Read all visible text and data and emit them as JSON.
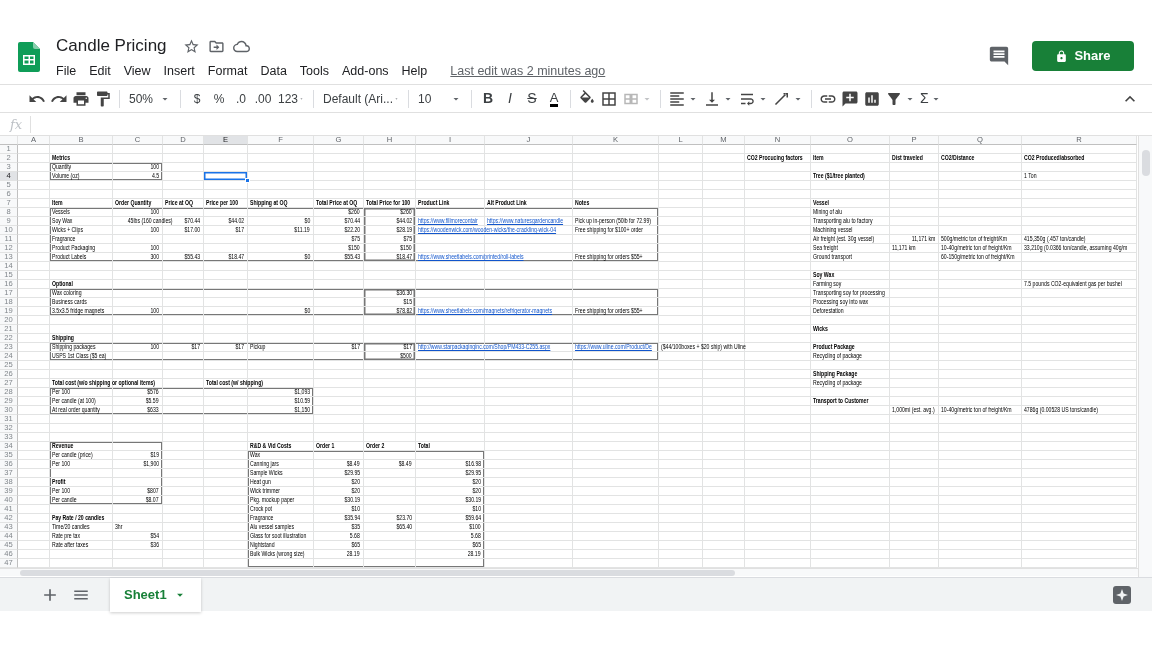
{
  "document": {
    "title": "Candle Pricing",
    "last_edit": "Last edit was 2 minutes ago"
  },
  "menu": [
    "File",
    "Edit",
    "View",
    "Insert",
    "Format",
    "Data",
    "Tools",
    "Add-ons",
    "Help"
  ],
  "share_button": "Share",
  "toolbar": {
    "zoom": "50%",
    "currency": "$",
    "percent": "%",
    "decrease_decimals": ".0",
    "increase_decimals": ".00",
    "number_format": "123",
    "font": "Default (Ari...",
    "font_size": "10",
    "bold": "B",
    "italic": "I",
    "strikethrough": "S",
    "text_color": "A",
    "merge": {
      "disabled": true
    },
    "functions": "Σ"
  },
  "formula_bar": {
    "label": "fx"
  },
  "columns": [
    {
      "label": "A",
      "selected": false
    },
    {
      "label": "B",
      "selected": false
    },
    {
      "label": "C",
      "selected": false
    },
    {
      "label": "D",
      "selected": false
    },
    {
      "label": "E",
      "selected": true
    },
    {
      "label": "F",
      "selected": false
    },
    {
      "label": "G",
      "selected": false
    },
    {
      "label": "H",
      "selected": false
    },
    {
      "label": "I",
      "selected": false
    },
    {
      "label": "J",
      "selected": false
    },
    {
      "label": "K",
      "selected": false
    },
    {
      "label": "L",
      "selected": false
    },
    {
      "label": "M",
      "selected": false
    },
    {
      "label": "N",
      "selected": false
    },
    {
      "label": "O",
      "selected": false
    },
    {
      "label": "P",
      "selected": false
    },
    {
      "label": "Q",
      "selected": false
    },
    {
      "label": "R",
      "selected": false
    }
  ],
  "rows": [
    {
      "number": "1",
      "selected": false
    },
    {
      "number": "2",
      "selected": false,
      "cells": {
        "B": {
          "kind": "heading",
          "text": "Metrics"
        },
        "N": {
          "kind": "heading",
          "text": "CO2 Procucing factors"
        },
        "O": {
          "kind": "heading",
          "text": "Item"
        },
        "P": {
          "kind": "heading",
          "text": "Dist traveled"
        },
        "Q": {
          "kind": "heading",
          "text": "CO2/Distance"
        },
        "R": {
          "kind": "heading",
          "text": "CO2 Produced/absorbed"
        }
      }
    },
    {
      "number": "3",
      "selected": false,
      "cells": {
        "B": {
          "kind": "text",
          "text": "Quantity"
        },
        "C": {
          "kind": "number",
          "text": "100"
        }
      }
    },
    {
      "number": "4",
      "selected": true,
      "cells": {
        "B": {
          "kind": "text",
          "text": "Volume (oz)"
        },
        "C": {
          "kind": "number",
          "text": "4.5"
        },
        "O": {
          "kind": "heading",
          "text": "Tree ($1/tree planted)"
        },
        "R": {
          "kind": "text",
          "text": "1 Ton"
        }
      }
    },
    {
      "number": "5",
      "selected": false
    },
    {
      "number": "6",
      "selected": false
    },
    {
      "number": "7",
      "selected": false,
      "cells": {
        "B": {
          "kind": "heading",
          "text": "Item"
        },
        "C": {
          "kind": "heading",
          "text": "Order Quantity"
        },
        "D": {
          "kind": "heading",
          "text": "Price at OQ"
        },
        "E": {
          "kind": "heading",
          "text": "Price per 100"
        },
        "F": {
          "kind": "heading",
          "text": "Shipping at OQ"
        },
        "G": {
          "kind": "heading",
          "text": "Total Price at OQ"
        },
        "H": {
          "kind": "heading",
          "text": "Total Price for 100"
        },
        "I": {
          "kind": "heading",
          "text": "Product Link"
        },
        "J": {
          "kind": "heading",
          "text": "Alt Product Link"
        },
        "K": {
          "kind": "heading",
          "text": "Notes"
        },
        "O": {
          "kind": "heading",
          "text": "Vessel"
        }
      }
    },
    {
      "number": "8",
      "selected": false,
      "cells": {
        "B": {
          "kind": "text",
          "text": "Vessels"
        },
        "C": {
          "kind": "number",
          "text": "100"
        },
        "G": {
          "kind": "number",
          "text": "$260"
        },
        "H": {
          "kind": "number",
          "text": "$260"
        },
        "O": {
          "kind": "text",
          "text": "Mining of alu"
        }
      }
    },
    {
      "number": "9",
      "selected": false,
      "cells": {
        "B": {
          "kind": "text",
          "text": "Soy Wax"
        },
        "C": {
          "kind": "number",
          "text": "45lbs (160 candles)"
        },
        "D": {
          "kind": "number",
          "text": "$70.44"
        },
        "E": {
          "kind": "number",
          "text": "$44.02"
        },
        "F": {
          "kind": "number",
          "text": "$0"
        },
        "G": {
          "kind": "number",
          "text": "$70.44"
        },
        "H": {
          "kind": "number",
          "text": "$44.02"
        },
        "I": {
          "kind": "link",
          "text": "https://www.fillmorecontair"
        },
        "J": {
          "kind": "link",
          "text": "https://www.naturesgardencandle"
        },
        "K": {
          "kind": "text",
          "text": "Pick up in-person (50lb for 72.99)"
        },
        "O": {
          "kind": "text",
          "text": "Transporting alu to factory"
        }
      }
    },
    {
      "number": "10",
      "selected": false,
      "cells": {
        "B": {
          "kind": "text",
          "text": "Wicks + Clips"
        },
        "C": {
          "kind": "number",
          "text": "100"
        },
        "D": {
          "kind": "number",
          "text": "$17.00"
        },
        "E": {
          "kind": "number",
          "text": "$17"
        },
        "F": {
          "kind": "number",
          "text": "$11.19"
        },
        "G": {
          "kind": "number",
          "text": "$22.20"
        },
        "H": {
          "kind": "number",
          "text": "$28.19"
        },
        "I": {
          "kind": "link",
          "text": "https://woodenwick.com/wooden-wicks/the-crackling-wick-04"
        },
        "K": {
          "kind": "text",
          "text": "Free shipping for $100+ order"
        },
        "O": {
          "kind": "text",
          "text": "Machining vessel"
        }
      }
    },
    {
      "number": "11",
      "selected": false,
      "cells": {
        "B": {
          "kind": "text",
          "text": "Fragrance"
        },
        "G": {
          "kind": "number",
          "text": "$75"
        },
        "H": {
          "kind": "number",
          "text": "$75"
        },
        "O": {
          "kind": "text",
          "text": "Air freight (est. 30g vessel)"
        },
        "P": {
          "kind": "number",
          "text": "11,171 km"
        },
        "Q": {
          "kind": "text",
          "text": "500g/metric ton of freight/Km"
        },
        "R": {
          "kind": "text",
          "text": "415,350g (.457 ton/candle)"
        }
      }
    },
    {
      "number": "12",
      "selected": false,
      "cells": {
        "B": {
          "kind": "text",
          "text": "Product Packaging"
        },
        "C": {
          "kind": "number",
          "text": "100"
        },
        "G": {
          "kind": "number",
          "text": "$150"
        },
        "H": {
          "kind": "number",
          "text": "$150"
        },
        "O": {
          "kind": "text",
          "text": "Sea freight"
        },
        "P": {
          "kind": "text",
          "text": "11,171 km"
        },
        "Q": {
          "kind": "text",
          "text": "10-40g/metric ton of freight/Km"
        },
        "R": {
          "kind": "text",
          "text": "33,210g (0.0366 ton/candle, assuming 40g/m"
        }
      }
    },
    {
      "number": "13",
      "selected": false,
      "cells": {
        "B": {
          "kind": "text",
          "text": "Product Labels"
        },
        "C": {
          "kind": "number",
          "text": "300"
        },
        "D": {
          "kind": "number",
          "text": "$55.43"
        },
        "E": {
          "kind": "number",
          "text": "$18.47"
        },
        "F": {
          "kind": "number",
          "text": "$0"
        },
        "G": {
          "kind": "number",
          "text": "$55.43"
        },
        "H": {
          "kind": "number",
          "text": "$18.47"
        },
        "I": {
          "kind": "link",
          "text": "https://www.sheetlabels.com/printed/roll-labels"
        },
        "K": {
          "kind": "text",
          "text": "Free shipping for orders $55+"
        },
        "O": {
          "kind": "text",
          "text": "Ground transport"
        },
        "Q": {
          "kind": "text",
          "text": "60-150g/metric ton of freight/Km"
        }
      }
    },
    {
      "number": "14",
      "selected": false
    },
    {
      "number": "15",
      "selected": false,
      "cells": {
        "O": {
          "kind": "heading",
          "text": "Soy Wax"
        }
      }
    },
    {
      "number": "16",
      "selected": false,
      "cells": {
        "B": {
          "kind": "heading",
          "text": "Optional"
        },
        "O": {
          "kind": "text",
          "text": "Farming soy"
        },
        "R": {
          "kind": "text",
          "text": "7.5 pounds CO2-equivalent gas per bushel"
        }
      }
    },
    {
      "number": "17",
      "selected": false,
      "cells": {
        "B": {
          "kind": "text",
          "text": "Wax coloring"
        },
        "H": {
          "kind": "number",
          "text": "$36.30"
        },
        "O": {
          "kind": "text",
          "text": "Transporting soy for processing"
        }
      }
    },
    {
      "number": "18",
      "selected": false,
      "cells": {
        "B": {
          "kind": "text",
          "text": "Business cards"
        },
        "H": {
          "kind": "number",
          "text": "$15"
        },
        "O": {
          "kind": "text",
          "text": "Processing soy into wax"
        }
      }
    },
    {
      "number": "19",
      "selected": false,
      "cells": {
        "B": {
          "kind": "text",
          "text": "3.5x3.5 fridge magnets"
        },
        "C": {
          "kind": "number",
          "text": "100"
        },
        "F": {
          "kind": "number",
          "text": "$0"
        },
        "H": {
          "kind": "number",
          "text": "$78.82"
        },
        "I": {
          "kind": "link",
          "text": "https://www.sheetlabels.com/magnets/refrigerator-magnets"
        },
        "K": {
          "kind": "text",
          "text": "Free shipping for orders $55+"
        },
        "O": {
          "kind": "text",
          "text": "Deforestation"
        }
      }
    },
    {
      "number": "20",
      "selected": false
    },
    {
      "number": "21",
      "selected": false,
      "cells": {
        "O": {
          "kind": "heading",
          "text": "Wicks"
        }
      }
    },
    {
      "number": "22",
      "selected": false,
      "cells": {
        "B": {
          "kind": "heading",
          "text": "Shipping"
        }
      }
    },
    {
      "number": "23",
      "selected": false,
      "cells": {
        "B": {
          "kind": "text",
          "text": "Shipping packages"
        },
        "C": {
          "kind": "number",
          "text": "100"
        },
        "D": {
          "kind": "number",
          "text": "$17"
        },
        "E": {
          "kind": "number",
          "text": "$17"
        },
        "F": {
          "kind": "text",
          "text": "Pickup"
        },
        "G": {
          "kind": "number",
          "text": "$17"
        },
        "H": {
          "kind": "number",
          "text": "$17"
        },
        "I": {
          "kind": "link",
          "text": "http://www.starpackaginginc.com/Shop/PM433-C255.aspx"
        },
        "K": {
          "kind": "link",
          "text": "https://www.uline.com/Product/De"
        },
        "L": {
          "kind": "text",
          "text": "($44/100boxes + $20 ship) with Uline"
        },
        "O": {
          "kind": "heading",
          "text": "Product Package"
        }
      }
    },
    {
      "number": "24",
      "selected": false,
      "cells": {
        "B": {
          "kind": "text",
          "text": "USPS 1st Class ($5 ea)"
        },
        "H": {
          "kind": "number",
          "text": "$500"
        },
        "O": {
          "kind": "text",
          "text": "Recycling of package"
        }
      }
    },
    {
      "number": "25",
      "selected": false
    },
    {
      "number": "26",
      "selected": false,
      "cells": {
        "O": {
          "kind": "heading",
          "text": "Shipping Package"
        }
      }
    },
    {
      "number": "27",
      "selected": false,
      "cells": {
        "B": {
          "kind": "heading",
          "text": "Total cost (w/o shipping or optional items)"
        },
        "E": {
          "kind": "heading",
          "text": "Total cost (w/ shipping)"
        },
        "O": {
          "kind": "text",
          "text": "Recycling of package"
        }
      }
    },
    {
      "number": "28",
      "selected": false,
      "cells": {
        "B": {
          "kind": "text",
          "text": "Per 100"
        },
        "C": {
          "kind": "number",
          "text": "$576"
        },
        "F": {
          "kind": "number",
          "text": "$1,093"
        }
      }
    },
    {
      "number": "29",
      "selected": false,
      "cells": {
        "B": {
          "kind": "text",
          "text": "Per candle (at 100)"
        },
        "C": {
          "kind": "number",
          "text": "$5.59"
        },
        "F": {
          "kind": "number",
          "text": "$10.59"
        },
        "O": {
          "kind": "heading",
          "text": "Transport to Customer"
        }
      }
    },
    {
      "number": "30",
      "selected": false,
      "cells": {
        "B": {
          "kind": "text",
          "text": "At real order quantity"
        },
        "C": {
          "kind": "number",
          "text": "$633"
        },
        "F": {
          "kind": "number",
          "text": "$1,150"
        },
        "P": {
          "kind": "text",
          "text": "1,000mi (est. avg.)"
        },
        "Q": {
          "kind": "text",
          "text": "10-40g/metric ton of freight/Km"
        },
        "R": {
          "kind": "text",
          "text": "4786g (0.00528 US tons/candle)"
        }
      }
    },
    {
      "number": "31",
      "selected": false
    },
    {
      "number": "32",
      "selected": false
    },
    {
      "number": "33",
      "selected": false
    },
    {
      "number": "34",
      "selected": false,
      "cells": {
        "B": {
          "kind": "heading",
          "text": "Revenue"
        },
        "F": {
          "kind": "heading",
          "text": "R&D & Vid Costs"
        },
        "G": {
          "kind": "heading",
          "text": "Order 1"
        },
        "H": {
          "kind": "heading",
          "text": "Order 2"
        },
        "I": {
          "kind": "heading",
          "text": "Total"
        }
      }
    },
    {
      "number": "35",
      "selected": false,
      "cells": {
        "B": {
          "kind": "text",
          "text": "Per candle (price)"
        },
        "C": {
          "kind": "number",
          "text": "$19"
        },
        "F": {
          "kind": "text",
          "text": "Wax"
        }
      }
    },
    {
      "number": "36",
      "selected": false,
      "cells": {
        "B": {
          "kind": "text",
          "text": "Per 100"
        },
        "C": {
          "kind": "number",
          "text": "$1,900"
        },
        "F": {
          "kind": "text",
          "text": "Canning jars"
        },
        "G": {
          "kind": "number",
          "text": "$8.49"
        },
        "H": {
          "kind": "number",
          "text": "$8.49"
        },
        "I": {
          "kind": "number",
          "text": "$16.98"
        }
      }
    },
    {
      "number": "37",
      "selected": false,
      "cells": {
        "F": {
          "kind": "text",
          "text": "Sample Wicks"
        },
        "G": {
          "kind": "number",
          "text": "$29.95"
        },
        "I": {
          "kind": "number",
          "text": "$29.95"
        }
      }
    },
    {
      "number": "38",
      "selected": false,
      "cells": {
        "B": {
          "kind": "heading",
          "text": "Profit"
        },
        "F": {
          "kind": "text",
          "text": "Heat gun"
        },
        "G": {
          "kind": "number",
          "text": "$20"
        },
        "I": {
          "kind": "number",
          "text": "$20"
        }
      }
    },
    {
      "number": "39",
      "selected": false,
      "cells": {
        "B": {
          "kind": "text",
          "text": "Per 100"
        },
        "C": {
          "kind": "number",
          "text": "$807"
        },
        "F": {
          "kind": "text",
          "text": "Wick trimmer"
        },
        "G": {
          "kind": "number",
          "text": "$20"
        },
        "I": {
          "kind": "number",
          "text": "$20"
        }
      }
    },
    {
      "number": "40",
      "selected": false,
      "cells": {
        "B": {
          "kind": "text",
          "text": "Per candle"
        },
        "C": {
          "kind": "number",
          "text": "$8.07"
        },
        "F": {
          "kind": "text",
          "text": "Pkg. mockup paper"
        },
        "G": {
          "kind": "number",
          "text": "$30.19"
        },
        "I": {
          "kind": "number",
          "text": "$30.19"
        }
      }
    },
    {
      "number": "41",
      "selected": false,
      "cells": {
        "F": {
          "kind": "text",
          "text": "Crock pot"
        },
        "G": {
          "kind": "number",
          "text": "$10"
        },
        "I": {
          "kind": "number",
          "text": "$10"
        }
      }
    },
    {
      "number": "42",
      "selected": false,
      "cells": {
        "B": {
          "kind": "heading",
          "text": "Pay Rate / 20 candles"
        },
        "F": {
          "kind": "text",
          "text": "Fragrance"
        },
        "G": {
          "kind": "number",
          "text": "$35.94"
        },
        "H": {
          "kind": "number",
          "text": "$23.70"
        },
        "I": {
          "kind": "number",
          "text": "$59.64"
        }
      }
    },
    {
      "number": "43",
      "selected": false,
      "cells": {
        "B": {
          "kind": "text",
          "text": "Time/20 candles"
        },
        "C": {
          "kind": "text",
          "text": "3hr"
        },
        "F": {
          "kind": "text",
          "text": "Alu vessel samples"
        },
        "G": {
          "kind": "number",
          "text": "$35"
        },
        "H": {
          "kind": "number",
          "text": "$65.40"
        },
        "I": {
          "kind": "number",
          "text": "$100"
        }
      }
    },
    {
      "number": "44",
      "selected": false,
      "cells": {
        "B": {
          "kind": "text",
          "text": "Rate pre tax"
        },
        "C": {
          "kind": "number",
          "text": "$54"
        },
        "F": {
          "kind": "text",
          "text": "Glass for soot illustration"
        },
        "G": {
          "kind": "number",
          "text": "5.68"
        },
        "I": {
          "kind": "number",
          "text": "5.68"
        }
      }
    },
    {
      "number": "45",
      "selected": false,
      "cells": {
        "B": {
          "kind": "text",
          "text": "Rate after taxes"
        },
        "C": {
          "kind": "number",
          "text": "$36"
        },
        "F": {
          "kind": "text",
          "text": "Nightstand"
        },
        "G": {
          "kind": "number",
          "text": "$65"
        },
        "I": {
          "kind": "number",
          "text": "$65"
        }
      }
    },
    {
      "number": "46",
      "selected": false,
      "cells": {
        "F": {
          "kind": "text",
          "text": "Bulk Wicks (wrong size)"
        },
        "G": {
          "kind": "number",
          "text": "28.19"
        },
        "I": {
          "kind": "number",
          "text": "28.19"
        }
      }
    },
    {
      "number": "47",
      "selected": false
    }
  ],
  "borders": {
    "B3:C4": {
      "heavy": false
    },
    "B8:K13": {
      "heavy": false
    },
    "H8:H13": {
      "heavy": true
    },
    "B17:K19": {
      "heavy": false
    },
    "H17:H19": {
      "heavy": true
    },
    "B23:K24": {
      "heavy": false
    },
    "H23:H24": {
      "heavy": true
    },
    "B28:F30": {
      "heavy": false
    },
    "B34:C40": {
      "heavy": false
    },
    "F35:I47": {
      "heavy": false
    }
  },
  "sheets": [
    {
      "name": "Sheet1",
      "selected": true
    }
  ]
}
